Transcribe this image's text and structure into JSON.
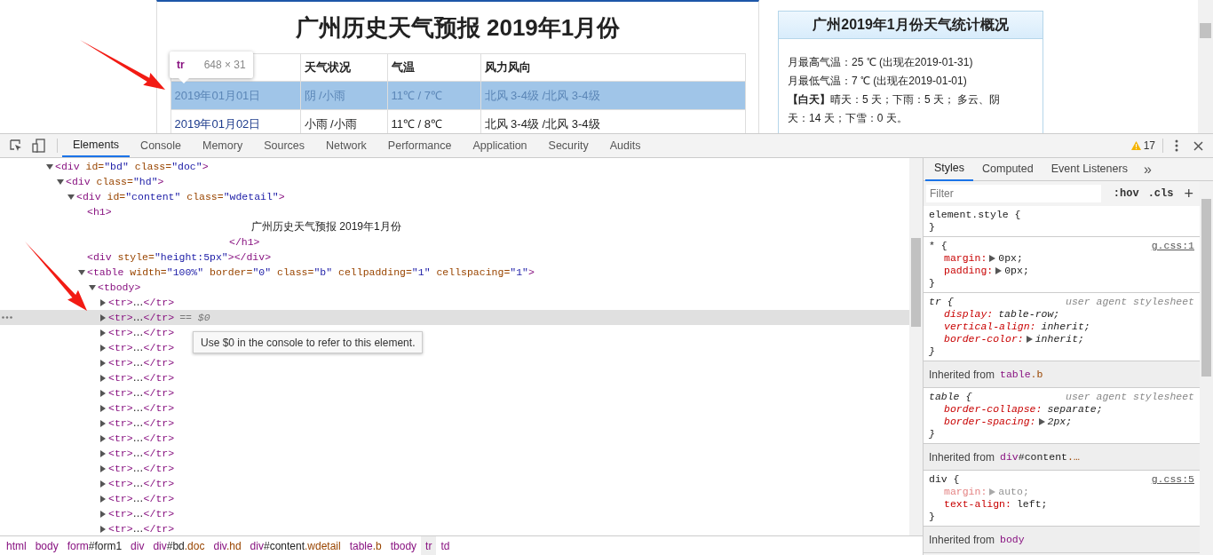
{
  "page": {
    "title": "广州历史天气预报 2019年1月份",
    "highlight_tooltip": {
      "tag": "tr",
      "size": "648 × 31"
    },
    "table": {
      "columns": [
        "",
        "天气状况",
        "气温",
        "风力风向"
      ],
      "rows": [
        {
          "selected": true,
          "cells": [
            "2019年01月01日",
            "阴 /小雨",
            "11℃ / 7℃",
            "北风 3-4级 /北风 3-4级"
          ]
        },
        {
          "selected": false,
          "cells": [
            "2019年01月02日",
            "小雨 /小雨",
            "11℃ / 8℃",
            "北风 3-4级 /北风 3-4级"
          ]
        }
      ]
    },
    "summary": {
      "title": "广州2019年1月份天气统计概况",
      "lines": [
        "月最高气温：25 ℃ (出现在2019-01-31)",
        "月最低气温：7 ℃ (出现在2019-01-01)",
        "**【白天】**晴天：5 天；下雨：5 天； 多云、阴天：14 天；下雪：0 天。"
      ]
    }
  },
  "devtools": {
    "tabs": [
      {
        "label": "Elements",
        "selected": true
      },
      {
        "label": "Console",
        "selected": false
      },
      {
        "label": "Memory",
        "selected": false
      },
      {
        "label": "Sources",
        "selected": false
      },
      {
        "label": "Network",
        "selected": false
      },
      {
        "label": "Performance",
        "selected": false
      },
      {
        "label": "Application",
        "selected": false
      },
      {
        "label": "Security",
        "selected": false
      },
      {
        "label": "Audits",
        "selected": false
      }
    ],
    "warnings": "17",
    "dom_tree": [
      {
        "kind": "element",
        "expanded": true,
        "selected": false,
        "segments": [
          {
            "kind": "tag",
            "text": "<div"
          },
          {
            "kind": "attr",
            "text": " id="
          },
          {
            "kind": "val",
            "text": "\"bd\""
          },
          {
            "kind": "attr",
            "text": " class="
          },
          {
            "kind": "val",
            "text": "\"doc\""
          },
          {
            "kind": "tag",
            "text": ">"
          }
        ],
        "children": [
          {
            "kind": "element",
            "expanded": true,
            "selected": false,
            "segments": [
              {
                "kind": "tag",
                "text": "<div"
              },
              {
                "kind": "attr",
                "text": " class="
              },
              {
                "kind": "val",
                "text": "\"hd\""
              },
              {
                "kind": "tag",
                "text": ">"
              }
            ],
            "children": [
              {
                "kind": "element",
                "expanded": true,
                "selected": false,
                "segments": [
                  {
                    "kind": "tag",
                    "text": "<div"
                  },
                  {
                    "kind": "attr",
                    "text": " id="
                  },
                  {
                    "kind": "val",
                    "text": "\"content\""
                  },
                  {
                    "kind": "attr",
                    "text": " class="
                  },
                  {
                    "kind": "val",
                    "text": "\"wdetail\""
                  },
                  {
                    "kind": "tag",
                    "text": ">"
                  }
                ],
                "children": [
                  {
                    "kind": "element",
                    "selected": false,
                    "segments": [
                      {
                        "kind": "tag",
                        "text": "<h1>"
                      }
                    ],
                    "children": [
                      {
                        "kind": "text",
                        "selected": false,
                        "segments": [
                          {
                            "kind": "text",
                            "text": "广州历史天气预报 2019年1月份"
                          }
                        ]
                      },
                      {
                        "kind": "close",
                        "selected": false,
                        "segments": [
                          {
                            "kind": "tag",
                            "text": "</h1>"
                          }
                        ]
                      }
                    ]
                  },
                  {
                    "kind": "element",
                    "selected": false,
                    "segments": [
                      {
                        "kind": "tag",
                        "text": "<div"
                      },
                      {
                        "kind": "attr",
                        "text": " style="
                      },
                      {
                        "kind": "val",
                        "text": "\"height:5px\""
                      },
                      {
                        "kind": "tag",
                        "text": "></div>"
                      }
                    ]
                  },
                  {
                    "kind": "element",
                    "expanded": true,
                    "selected": false,
                    "segments": [
                      {
                        "kind": "tag",
                        "text": "<table"
                      },
                      {
                        "kind": "attr",
                        "text": " width="
                      },
                      {
                        "kind": "val",
                        "text": "\"100%\""
                      },
                      {
                        "kind": "attr",
                        "text": " border="
                      },
                      {
                        "kind": "val",
                        "text": "\"0\""
                      },
                      {
                        "kind": "attr",
                        "text": " class="
                      },
                      {
                        "kind": "val",
                        "text": "\"b\""
                      },
                      {
                        "kind": "attr",
                        "text": " cellpadding="
                      },
                      {
                        "kind": "val",
                        "text": "\"1\""
                      },
                      {
                        "kind": "attr",
                        "text": " cellspacing="
                      },
                      {
                        "kind": "val",
                        "text": "\"1\""
                      },
                      {
                        "kind": "tag",
                        "text": ">"
                      }
                    ],
                    "children": [
                      {
                        "kind": "element",
                        "expanded": true,
                        "selected": false,
                        "segments": [
                          {
                            "kind": "tag",
                            "text": "<tbody>"
                          }
                        ],
                        "children": [
                          {
                            "kind": "element",
                            "expanded": false,
                            "selected": false,
                            "segments": [
                              {
                                "kind": "tag",
                                "text": "<tr>"
                              },
                              {
                                "kind": "text",
                                "text": "…"
                              },
                              {
                                "kind": "tag",
                                "text": "</tr>"
                              }
                            ]
                          },
                          {
                            "kind": "element",
                            "expanded": false,
                            "selected": true,
                            "console_ref": "== $0",
                            "segments": [
                              {
                                "kind": "tag",
                                "text": "<tr>"
                              },
                              {
                                "kind": "text",
                                "text": "…"
                              },
                              {
                                "kind": "tag",
                                "text": "</tr>"
                              }
                            ]
                          },
                          {
                            "kind": "element",
                            "expanded": false,
                            "selected": false,
                            "segments": [
                              {
                                "kind": "tag",
                                "text": "<tr>"
                              },
                              {
                                "kind": "text",
                                "text": "…"
                              },
                              {
                                "kind": "tag",
                                "text": "</tr>"
                              }
                            ]
                          },
                          {
                            "kind": "element",
                            "expanded": false,
                            "selected": false,
                            "segments": [
                              {
                                "kind": "tag",
                                "text": "<tr>"
                              },
                              {
                                "kind": "text",
                                "text": "…"
                              },
                              {
                                "kind": "tag",
                                "text": "</tr>"
                              }
                            ]
                          },
                          {
                            "kind": "element",
                            "expanded": false,
                            "selected": false,
                            "segments": [
                              {
                                "kind": "tag",
                                "text": "<tr>"
                              },
                              {
                                "kind": "text",
                                "text": "…"
                              },
                              {
                                "kind": "tag",
                                "text": "</tr>"
                              }
                            ]
                          },
                          {
                            "kind": "element",
                            "expanded": false,
                            "selected": false,
                            "segments": [
                              {
                                "kind": "tag",
                                "text": "<tr>"
                              },
                              {
                                "kind": "text",
                                "text": "…"
                              },
                              {
                                "kind": "tag",
                                "text": "</tr>"
                              }
                            ]
                          },
                          {
                            "kind": "element",
                            "expanded": false,
                            "selected": false,
                            "segments": [
                              {
                                "kind": "tag",
                                "text": "<tr>"
                              },
                              {
                                "kind": "text",
                                "text": "…"
                              },
                              {
                                "kind": "tag",
                                "text": "</tr>"
                              }
                            ]
                          },
                          {
                            "kind": "element",
                            "expanded": false,
                            "selected": false,
                            "segments": [
                              {
                                "kind": "tag",
                                "text": "<tr>"
                              },
                              {
                                "kind": "text",
                                "text": "…"
                              },
                              {
                                "kind": "tag",
                                "text": "</tr>"
                              }
                            ]
                          },
                          {
                            "kind": "element",
                            "expanded": false,
                            "selected": false,
                            "segments": [
                              {
                                "kind": "tag",
                                "text": "<tr>"
                              },
                              {
                                "kind": "text",
                                "text": "…"
                              },
                              {
                                "kind": "tag",
                                "text": "</tr>"
                              }
                            ]
                          },
                          {
                            "kind": "element",
                            "expanded": false,
                            "selected": false,
                            "segments": [
                              {
                                "kind": "tag",
                                "text": "<tr>"
                              },
                              {
                                "kind": "text",
                                "text": "…"
                              },
                              {
                                "kind": "tag",
                                "text": "</tr>"
                              }
                            ]
                          },
                          {
                            "kind": "element",
                            "expanded": false,
                            "selected": false,
                            "segments": [
                              {
                                "kind": "tag",
                                "text": "<tr>"
                              },
                              {
                                "kind": "text",
                                "text": "…"
                              },
                              {
                                "kind": "tag",
                                "text": "</tr>"
                              }
                            ]
                          },
                          {
                            "kind": "element",
                            "expanded": false,
                            "selected": false,
                            "segments": [
                              {
                                "kind": "tag",
                                "text": "<tr>"
                              },
                              {
                                "kind": "text",
                                "text": "…"
                              },
                              {
                                "kind": "tag",
                                "text": "</tr>"
                              }
                            ]
                          },
                          {
                            "kind": "element",
                            "expanded": false,
                            "selected": false,
                            "segments": [
                              {
                                "kind": "tag",
                                "text": "<tr>"
                              },
                              {
                                "kind": "text",
                                "text": "…"
                              },
                              {
                                "kind": "tag",
                                "text": "</tr>"
                              }
                            ]
                          },
                          {
                            "kind": "element",
                            "expanded": false,
                            "selected": false,
                            "segments": [
                              {
                                "kind": "tag",
                                "text": "<tr>"
                              },
                              {
                                "kind": "text",
                                "text": "…"
                              },
                              {
                                "kind": "tag",
                                "text": "</tr>"
                              }
                            ]
                          },
                          {
                            "kind": "element",
                            "expanded": false,
                            "selected": false,
                            "segments": [
                              {
                                "kind": "tag",
                                "text": "<tr>"
                              },
                              {
                                "kind": "text",
                                "text": "…"
                              },
                              {
                                "kind": "tag",
                                "text": "</tr>"
                              }
                            ]
                          },
                          {
                            "kind": "element",
                            "expanded": false,
                            "selected": false,
                            "segments": [
                              {
                                "kind": "tag",
                                "text": "<tr>"
                              },
                              {
                                "kind": "text",
                                "text": "…"
                              },
                              {
                                "kind": "tag",
                                "text": "</tr>"
                              }
                            ]
                          }
                        ]
                      }
                    ]
                  }
                ]
              }
            ]
          }
        ]
      }
    ],
    "console_tip": "Use $0 in the console to refer to this element.",
    "breadcrumbs": [
      {
        "selected": false,
        "parts": [
          {
            "kind": "tag",
            "text": "html"
          }
        ]
      },
      {
        "selected": false,
        "parts": [
          {
            "kind": "tag",
            "text": "body"
          }
        ]
      },
      {
        "selected": false,
        "parts": [
          {
            "kind": "tag",
            "text": "form"
          },
          {
            "kind": "id",
            "text": "#form1"
          }
        ]
      },
      {
        "selected": false,
        "parts": [
          {
            "kind": "tag",
            "text": "div"
          }
        ]
      },
      {
        "selected": false,
        "parts": [
          {
            "kind": "tag",
            "text": "div"
          },
          {
            "kind": "id",
            "text": "#bd"
          },
          {
            "kind": "class",
            "text": ".doc"
          }
        ]
      },
      {
        "selected": false,
        "parts": [
          {
            "kind": "tag",
            "text": "div"
          },
          {
            "kind": "class",
            "text": ".hd"
          }
        ]
      },
      {
        "selected": false,
        "parts": [
          {
            "kind": "tag",
            "text": "div"
          },
          {
            "kind": "id",
            "text": "#content"
          },
          {
            "kind": "class",
            "text": ".wdetail"
          }
        ]
      },
      {
        "selected": false,
        "parts": [
          {
            "kind": "tag",
            "text": "table"
          },
          {
            "kind": "class",
            "text": ".b"
          }
        ]
      },
      {
        "selected": false,
        "parts": [
          {
            "kind": "tag",
            "text": "tbody"
          }
        ]
      },
      {
        "selected": true,
        "parts": [
          {
            "kind": "tag",
            "text": "tr"
          }
        ]
      },
      {
        "selected": false,
        "parts": [
          {
            "kind": "tag",
            "text": "td"
          }
        ]
      }
    ],
    "styles": {
      "tabs": [
        {
          "label": "Styles",
          "selected": true
        },
        {
          "label": "Computed",
          "selected": false
        },
        {
          "label": "Event Listeners",
          "selected": false
        }
      ],
      "more": "»",
      "filter_placeholder": "Filter",
      "hov": ":hov",
      "cls": ".cls",
      "add": "+",
      "blocks": [
        {
          "kind": "rule",
          "selector": "element.style {",
          "user_agent": false,
          "close": "}"
        },
        {
          "kind": "rule",
          "selector": "* {",
          "source": "g.css:1",
          "user_agent": false,
          "close": "}",
          "declarations": [
            {
              "name": "margin:",
              "value": "0px;",
              "expandable": true,
              "overridden": false
            },
            {
              "name": "padding:",
              "value": "0px;",
              "expandable": true,
              "overridden": false
            }
          ]
        },
        {
          "kind": "rule",
          "selector": "tr {",
          "source": "user agent stylesheet",
          "user_agent": true,
          "close": "}",
          "declarations": [
            {
              "name": "display:",
              "value": "table-row;",
              "expandable": false,
              "overridden": false
            },
            {
              "name": "vertical-align:",
              "value": "inherit;",
              "expandable": false,
              "overridden": false
            },
            {
              "name": "border-color:",
              "value": "inherit;",
              "expandable": true,
              "overridden": false
            }
          ]
        },
        {
          "kind": "inherited",
          "label": "Inherited from",
          "target": [
            {
              "kind": "tag",
              "text": "table"
            },
            {
              "kind": "class",
              "text": ".b"
            }
          ]
        },
        {
          "kind": "rule",
          "selector": "table {",
          "source": "user agent stylesheet",
          "user_agent": true,
          "close": "}",
          "declarations": [
            {
              "name": "border-collapse:",
              "value": "separate;",
              "expandable": false,
              "overridden": false
            },
            {
              "name": "border-spacing:",
              "value": "2px;",
              "expandable": true,
              "overridden": false
            }
          ]
        },
        {
          "kind": "inherited",
          "label": "Inherited from",
          "target": [
            {
              "kind": "tag",
              "text": "div"
            },
            {
              "kind": "id",
              "text": "#content"
            },
            {
              "kind": "class",
              "text": ".…"
            }
          ]
        },
        {
          "kind": "rule",
          "selector": "div {",
          "source": "g.css:5",
          "user_agent": false,
          "close": "}",
          "declarations": [
            {
              "name": "margin:",
              "value": "auto;",
              "expandable": true,
              "overridden": true
            },
            {
              "name": "text-align:",
              "value": "left;",
              "expandable": false,
              "overridden": false
            }
          ]
        },
        {
          "kind": "inherited",
          "label": "Inherited from",
          "target": [
            {
              "kind": "tag",
              "text": "body"
            }
          ]
        }
      ]
    }
  }
}
